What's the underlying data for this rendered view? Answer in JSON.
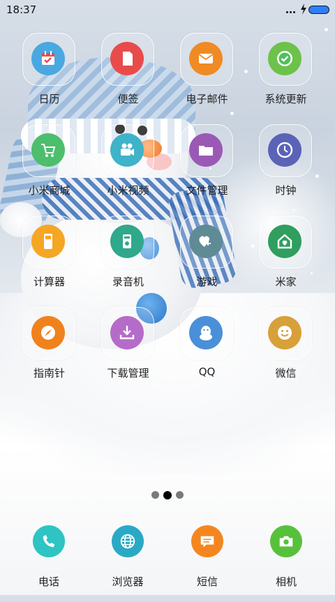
{
  "status_bar": {
    "time": "18:37"
  },
  "apps": [
    {
      "label": "日历",
      "icon": "calendar-icon",
      "color": "#4aa8e0"
    },
    {
      "label": "便签",
      "icon": "note-icon",
      "color": "#e94b4b"
    },
    {
      "label": "电子邮件",
      "icon": "mail-icon",
      "color": "#f08a24"
    },
    {
      "label": "系统更新",
      "icon": "update-check-icon",
      "color": "#6cc24a"
    },
    {
      "label": "小米商城",
      "icon": "cart-icon",
      "color": "#4cbe6c"
    },
    {
      "label": "小米视频",
      "icon": "video-camera-icon",
      "color": "#3fb3c8"
    },
    {
      "label": "文件管理",
      "icon": "folder-icon",
      "color": "#9b59b6"
    },
    {
      "label": "时钟",
      "icon": "clock-icon",
      "color": "#5b63b7"
    },
    {
      "label": "计算器",
      "icon": "calculator-icon",
      "color": "#f5a623"
    },
    {
      "label": "录音机",
      "icon": "recorder-icon",
      "color": "#2fa88c"
    },
    {
      "label": "游戏",
      "icon": "game-heart-icon",
      "color": "#5f8b95"
    },
    {
      "label": "米家",
      "icon": "home-icon",
      "color": "#2f9e5e"
    },
    {
      "label": "指南针",
      "icon": "compass-icon",
      "color": "#f0821e"
    },
    {
      "label": "下载管理",
      "icon": "download-icon",
      "color": "#b46cc8"
    },
    {
      "label": "QQ",
      "icon": "qq-penguin-icon",
      "color": "#4a90d9"
    },
    {
      "label": "微信",
      "icon": "smile-icon",
      "color": "#d8a03a"
    }
  ],
  "pager": {
    "count": 3,
    "active": 1
  },
  "dock": [
    {
      "label": "电话",
      "icon": "phone-icon",
      "color": "#2ec4c4"
    },
    {
      "label": "浏览器",
      "icon": "globe-icon",
      "color": "#2aa9c5"
    },
    {
      "label": "短信",
      "icon": "message-icon",
      "color": "#f5861f"
    },
    {
      "label": "相机",
      "icon": "camera-icon",
      "color": "#58c13b"
    }
  ]
}
